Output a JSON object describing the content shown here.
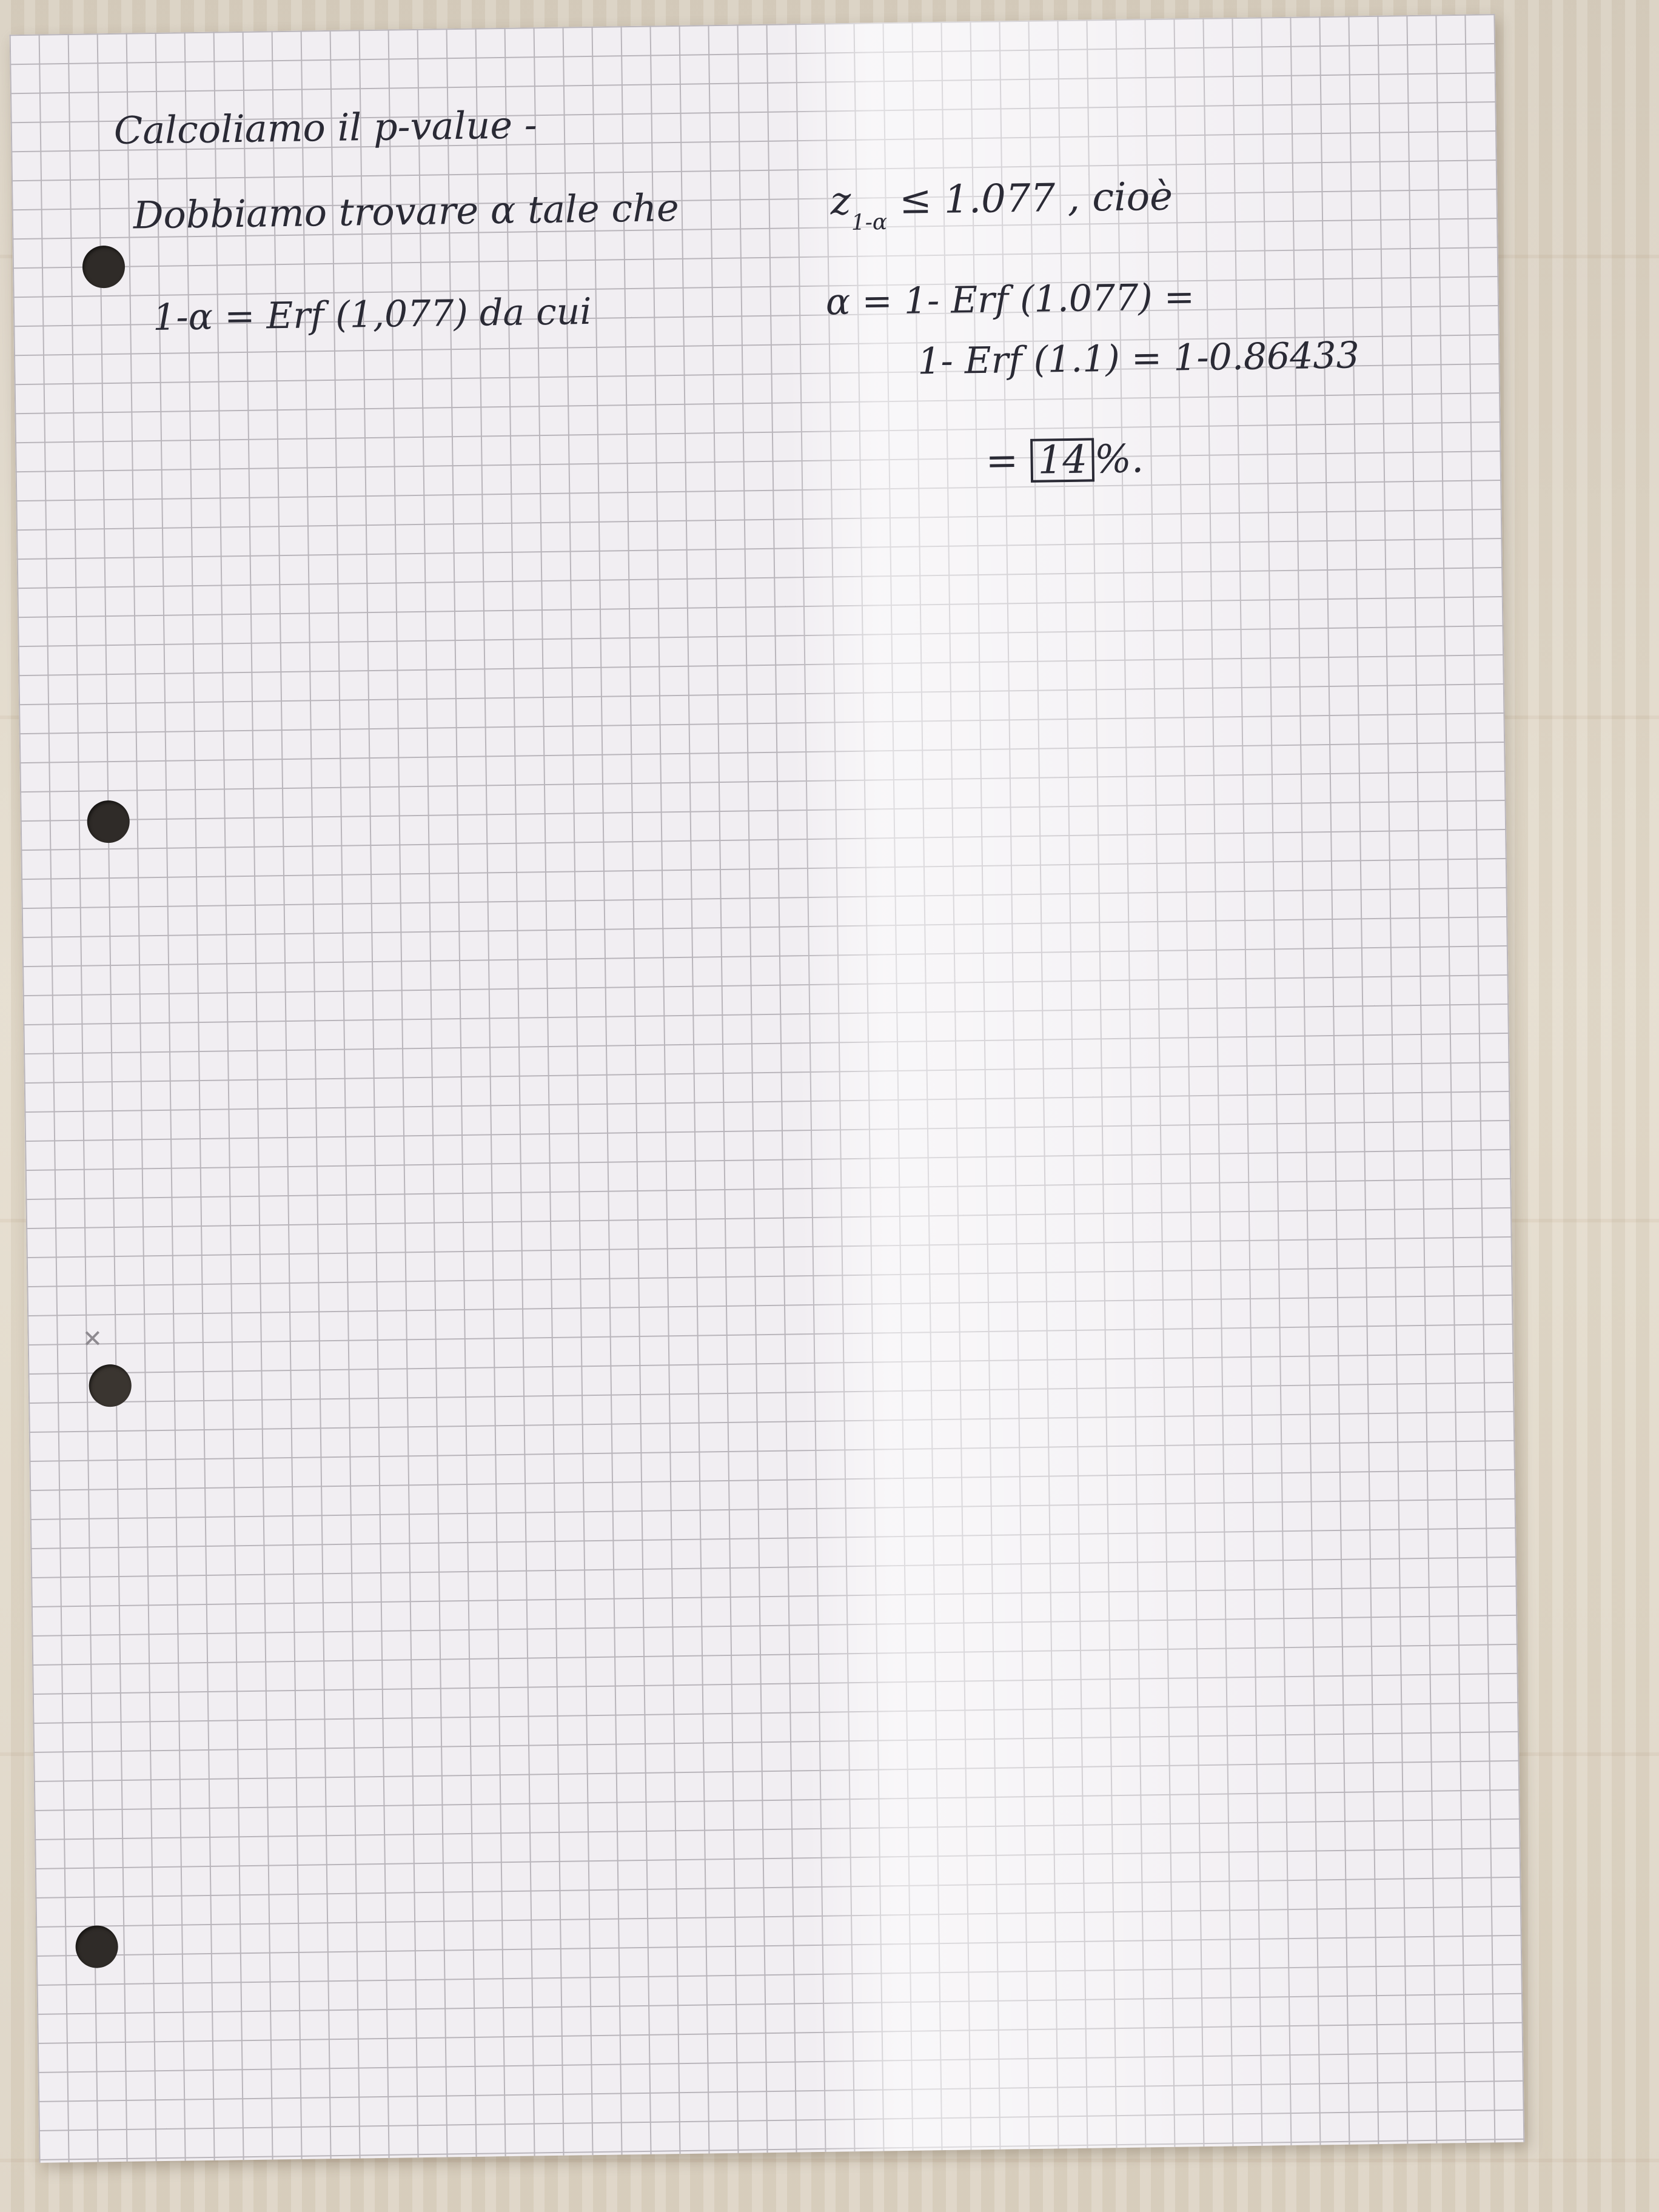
{
  "notes": {
    "line1": "Calcoliamo il p-value -",
    "line2_text": "Dobbiamo trovare α tale che",
    "line2_z": "z",
    "line2_sub": "1-α",
    "line2_rest": "≤ 1.077 , cioè",
    "line3_left": "1-α = Erf (1,077)  da  cui",
    "line3_right": "α = 1- Erf (1.077) =",
    "line4": "1- Erf (1.1) = 1-0.86433",
    "line5_prefix": "=",
    "line5_boxed": "14",
    "line5_suffix": "%."
  }
}
